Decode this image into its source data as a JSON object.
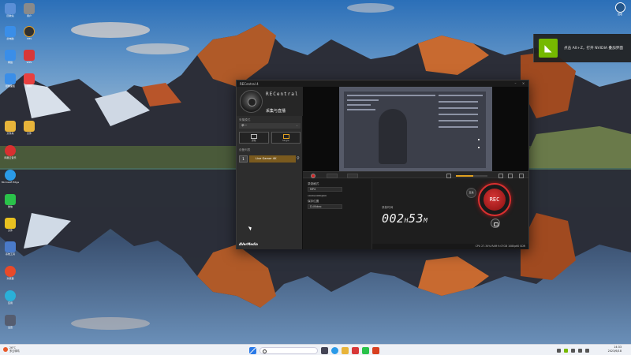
{
  "desktop": {
    "icons_col1": [
      {
        "label": "回收站",
        "color": "#5b8fd6"
      },
      {
        "label": "此电脑",
        "color": "#3a8ee8"
      },
      {
        "label": "网络",
        "color": "#3a8ee8"
      },
      {
        "label": "控制面板",
        "color": "#3a8ee8"
      },
      {
        "label": "文件夹",
        "color": "#e8b43a"
      },
      {
        "label": "网易云音乐",
        "color": "#d83030"
      },
      {
        "label": "Microsoft Edge",
        "color": "#2a9ae8"
      },
      {
        "label": "微信",
        "color": "#2ac24a"
      },
      {
        "label": "文件",
        "color": "#e8c020"
      },
      {
        "label": "系统工具",
        "color": "#4a7ac8"
      },
      {
        "label": "浏览器",
        "color": "#e84a2a"
      },
      {
        "label": "应用",
        "color": "#2ab0d8"
      },
      {
        "label": "设置",
        "color": "#555d70"
      }
    ],
    "icons_col2": [
      {
        "label": "用户",
        "color": "#8a8a8a"
      },
      {
        "label": "OBS",
        "color": "#303030"
      },
      {
        "label": "WPS",
        "color": "#d83838"
      },
      {
        "label": "视频",
        "color": "#e84040"
      },
      {
        "label": "文件",
        "color": "#e8b43a"
      }
    ],
    "top_right_icon": {
      "label": "回收",
      "icon": "aperture-icon"
    }
  },
  "toast": {
    "brand": "NVIDIA",
    "message": "点击 Alt+Z，打开 NVIDIA 叠加界面"
  },
  "app": {
    "title": "RECentral 4",
    "brand_text": "RECentral",
    "mode_label": "采集与直播",
    "section_mode": "采集模式",
    "mode_select": "单一",
    "section_device": "设备列表",
    "tiles": [
      {
        "label": "屏幕",
        "selected": false
      },
      {
        "label": "Single",
        "selected": true
      }
    ],
    "device": {
      "number": "1",
      "name": "Live Gamer 4K"
    },
    "vendor": "AVerMedia",
    "settings": {
      "format_label": "录制格式",
      "format_value": "MP4",
      "quality_label": "1920x1080@60",
      "folder_label": "保存位置",
      "folder_value": "D:/Video"
    },
    "record": {
      "duration_label": "录制时间",
      "timer_value": "002",
      "timer_unit_h": "H",
      "timer_minutes": "53",
      "timer_unit_m": "M",
      "rec_label": "REC",
      "side_button_label": "直播"
    },
    "status": "CPU 27.34%  RAM 9.07GB  1080p60 SDR",
    "volume_level": 0.55
  },
  "taskbar": {
    "weather_temp": "26°C",
    "weather_text": "多云转晴",
    "search_placeholder": "搜索",
    "clock_time": "14:33",
    "clock_date": "2023/6/18"
  }
}
